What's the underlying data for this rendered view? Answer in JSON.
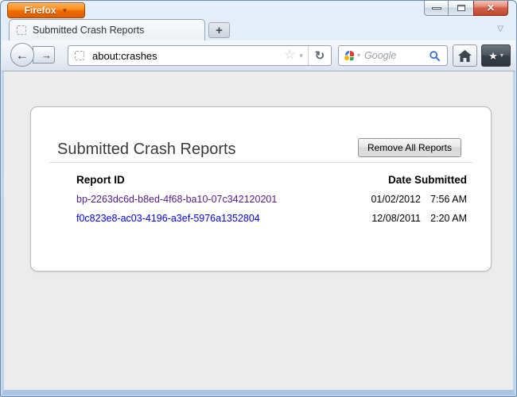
{
  "window": {
    "app_menu_label": "Firefox"
  },
  "icons": {
    "menu_caret": "▼",
    "close": "✕",
    "new_tab": "+",
    "list_tabs": "▽",
    "back_arrow": "←",
    "forward_arrow": "→",
    "bookmark_star_outline": "☆",
    "caret_down": "▾",
    "reload": "↻",
    "bookmarks_star": "★"
  },
  "tabs": {
    "active_tab_title": "Submitted Crash Reports"
  },
  "toolbar": {
    "url": "about:crashes",
    "search_placeholder": "Google"
  },
  "page": {
    "title": "Submitted Crash Reports",
    "remove_all_label": "Remove All Reports",
    "table": {
      "columns": [
        "Report ID",
        "Date Submitted"
      ],
      "rows": [
        {
          "id": "bp-2263dc6d-b8ed-4f68-ba10-07c342120201",
          "date": "01/02/2012",
          "time": "7:56 AM",
          "visited": true
        },
        {
          "id": "f0c823e8-ac03-4196-a3ef-5976a1352804",
          "date": "12/08/2011",
          "time": "2:20 AM",
          "visited": false
        }
      ]
    }
  },
  "colors": {
    "visited_link": "#551a8b",
    "link": "#0000ee",
    "firefox_orange": "#ef6d00",
    "close_red": "#bd4a2e",
    "card_background": "#ffffff",
    "content_background": "#ececec"
  }
}
